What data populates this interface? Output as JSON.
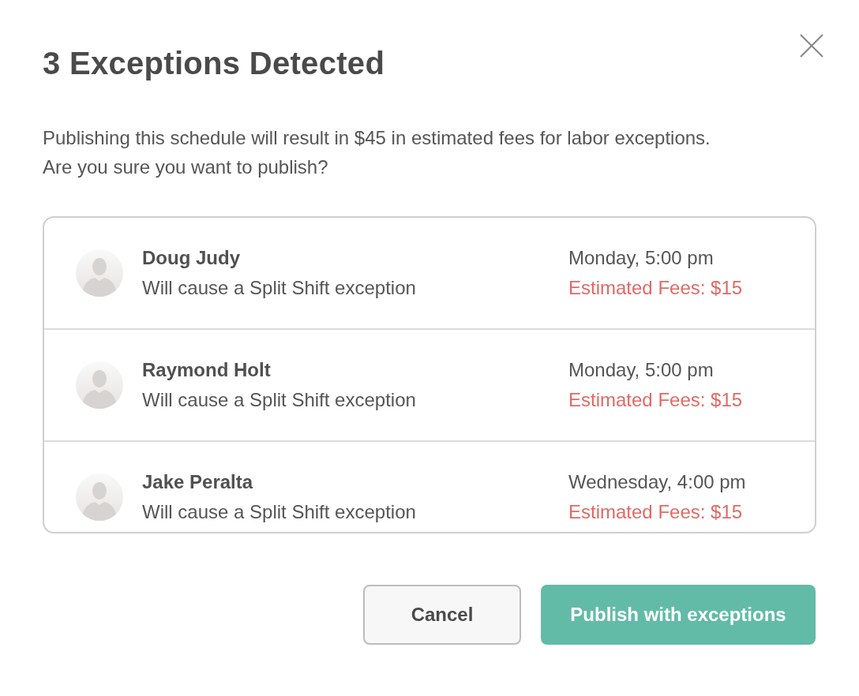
{
  "dialog": {
    "title": "3 Exceptions Detected",
    "message_lines": [
      "Publishing this schedule will result in $45 in estimated fees for labor exceptions.",
      "Are you sure you want to publish?"
    ]
  },
  "exceptions": [
    {
      "name": "Doug Judy",
      "description": "Will cause a Split Shift exception",
      "time": "Monday, 5:00 pm",
      "fee": "Estimated Fees: $15"
    },
    {
      "name": "Raymond Holt",
      "description": "Will cause a Split Shift exception",
      "time": "Monday, 5:00 pm",
      "fee": "Estimated Fees: $15"
    },
    {
      "name": "Jake Peralta",
      "description": "Will cause a Split Shift exception",
      "time": "Wednesday, 4:00 pm",
      "fee": "Estimated Fees: $15"
    }
  ],
  "buttons": [
    {
      "label": "Cancel",
      "kind": "secondary"
    },
    {
      "label": "Publish with exceptions",
      "kind": "primary"
    }
  ]
}
